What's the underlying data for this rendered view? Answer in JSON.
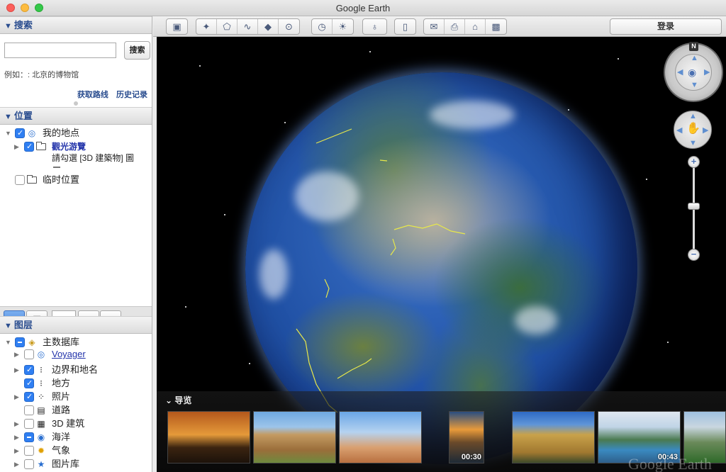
{
  "window": {
    "title": "Google Earth"
  },
  "search": {
    "header": "搜索",
    "button": "搜索",
    "example": "例如：: 北京的博物馆",
    "get_directions": "获取路线",
    "history": "历史记录"
  },
  "places": {
    "header": "位置",
    "items": [
      {
        "label": "我的地点"
      },
      {
        "label": "觀光游覽"
      },
      {
        "label": "請勾選 [3D 建築物] 圖"
      },
      {
        "label": "临时位置"
      }
    ]
  },
  "layers": {
    "header": "图层",
    "items": [
      {
        "label": "主数据库"
      },
      {
        "label": "Voyager"
      },
      {
        "label": "边界和地名"
      },
      {
        "label": "地方"
      },
      {
        "label": "照片"
      },
      {
        "label": "道路"
      },
      {
        "label": "3D 建筑"
      },
      {
        "label": "海洋"
      },
      {
        "label": "气象"
      },
      {
        "label": "图片库"
      }
    ]
  },
  "toolbar": {
    "login": "登录"
  },
  "navigation": {
    "north": "N"
  },
  "tour": {
    "label": "导览",
    "items": [
      {
        "duration": ""
      },
      {
        "duration": ""
      },
      {
        "duration": ""
      },
      {
        "duration": "00:30"
      },
      {
        "duration": ""
      },
      {
        "duration": "00:43"
      },
      {
        "duration": ""
      }
    ]
  },
  "watermark": "Google Earth"
}
